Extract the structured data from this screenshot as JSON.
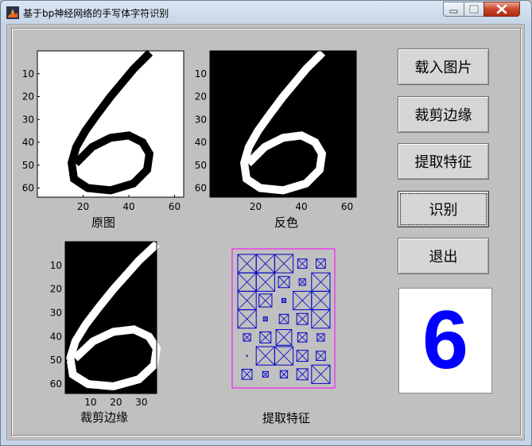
{
  "window": {
    "title": "基于bp神经网络的手写体字符识别"
  },
  "buttons": {
    "load": "载入图片",
    "crop": "裁剪边缘",
    "extract": "提取特征",
    "recognize": "识别",
    "exit": "退出"
  },
  "captions": {
    "original": "原图",
    "inverted": "反色",
    "cropped": "裁剪边缘",
    "features": "提取特征"
  },
  "axes": {
    "square_y_ticks": [
      "10",
      "20",
      "30",
      "40",
      "50",
      "60"
    ],
    "square_x_ticks": [
      "20",
      "40",
      "60"
    ],
    "crop_y_ticks": [
      "10",
      "20",
      "30",
      "40",
      "50",
      "60"
    ],
    "crop_x_ticks": [
      "10",
      "20",
      "30"
    ]
  },
  "result": {
    "digit": "6"
  },
  "colors": {
    "result_digit": "#0000ff",
    "feature_box": "#0000cc",
    "feature_frame": "#ff00ff"
  },
  "icons": {
    "app": "matlab-icon",
    "minimize": "minimize-icon",
    "maximize": "maximize-icon",
    "close": "close-icon"
  }
}
